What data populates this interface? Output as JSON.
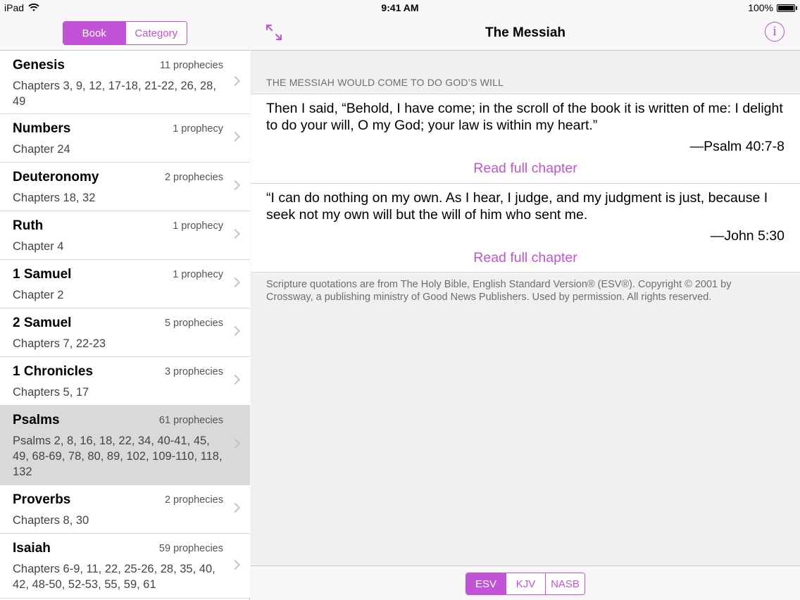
{
  "status": {
    "device": "iPad",
    "time": "9:41 AM",
    "battery": "100%"
  },
  "sidebar": {
    "segments": [
      {
        "label": "Book",
        "selected": true
      },
      {
        "label": "Category",
        "selected": false
      }
    ],
    "items": [
      {
        "title": "Genesis",
        "count": "11 prophecies",
        "sub": "Chapters 3, 9, 12, 17-18, 21-22, 26, 28, 49"
      },
      {
        "title": "Numbers",
        "count": "1 prophecy",
        "sub": "Chapter 24"
      },
      {
        "title": "Deuteronomy",
        "count": "2 prophecies",
        "sub": "Chapters 18, 32"
      },
      {
        "title": "Ruth",
        "count": "1 prophecy",
        "sub": "Chapter 4"
      },
      {
        "title": "1 Samuel",
        "count": "1 prophecy",
        "sub": "Chapter 2"
      },
      {
        "title": "2 Samuel",
        "count": "5 prophecies",
        "sub": "Chapters 7, 22-23"
      },
      {
        "title": "1 Chronicles",
        "count": "3 prophecies",
        "sub": "Chapters 5, 17"
      },
      {
        "title": "Psalms",
        "count": "61 prophecies",
        "sub": "Psalms 2, 8, 16, 18, 22, 34, 40-41, 45, 49, 68-69, 78, 80, 89, 102, 109-110, 118, 132"
      },
      {
        "title": "Proverbs",
        "count": "2 prophecies",
        "sub": "Chapters 8, 30"
      },
      {
        "title": "Isaiah",
        "count": "59 prophecies",
        "sub": "Chapters 6-9, 11, 22, 25-26, 28, 35, 40, 42, 48-50, 52-53, 55, 59, 61"
      }
    ]
  },
  "main": {
    "title": "The Messiah",
    "section_header": "THE MESSIAH WOULD COME TO DO GOD’S WILL",
    "verses": [
      {
        "text": "Then I said, “Behold, I have come; in the scroll of the book it is written of me: I delight to do your will, O my God; your law is within my heart.”",
        "reference": "—Psalm 40:7-8",
        "link": "Read full chapter"
      },
      {
        "text": "“I can do nothing on my own. As I hear, I judge, and my judgment is just, because I seek not my own will but the will of him who sent me.",
        "reference": "—John 5:30",
        "link": "Read full chapter"
      }
    ],
    "copyright": "Scripture quotations are from The Holy Bible, English Standard Version® (ESV®). Copyright © 2001 by Crossway, a publishing ministry of Good News Publishers. Used by permission. All rights reserved.",
    "versions": [
      {
        "label": "ESV",
        "selected": true
      },
      {
        "label": "KJV",
        "selected": false
      },
      {
        "label": "NASB",
        "selected": false
      }
    ]
  },
  "colors": {
    "accent": "#c253d6",
    "selected_row": "#d9d9d9"
  },
  "icons": {
    "expand": "expand-arrows-icon",
    "info": "info-icon",
    "wifi": "wifi-icon",
    "battery": "battery-icon",
    "chevron": "chevron-right-icon"
  }
}
